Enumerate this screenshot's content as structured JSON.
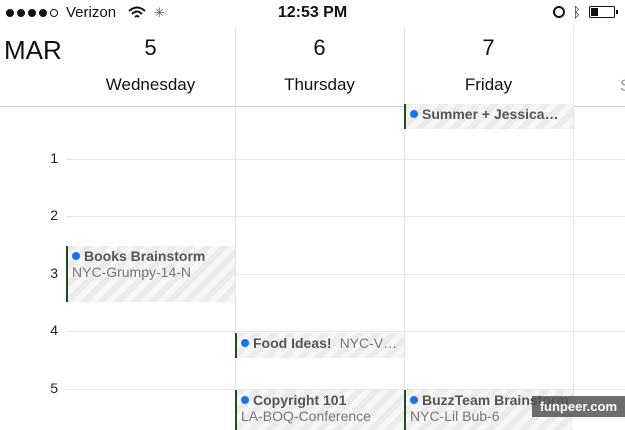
{
  "status_bar": {
    "carrier": "Verizon",
    "signal_bars_filled": 4,
    "signal_bars_total": 5,
    "time": "12:53 PM",
    "battery_level": 0.3
  },
  "header": {
    "month": "MAR",
    "days": [
      {
        "num": "5",
        "name": "Wednesday"
      },
      {
        "num": "6",
        "name": "Thursday"
      },
      {
        "num": "7",
        "name": "Friday"
      }
    ],
    "next_day_partial": "S"
  },
  "hours": [
    "1",
    "2",
    "3",
    "4",
    "5"
  ],
  "events": {
    "summer_jessica": {
      "title": "Summer + Jessica…"
    },
    "books_brainstorm": {
      "title": "Books Brainstorm",
      "location": "NYC-Grumpy-14-N"
    },
    "food_ideas": {
      "title": "Food Ideas!",
      "location": "NYC-V…"
    },
    "copyright_101": {
      "title": "Copyright 101",
      "location": "LA-BOQ-Conference"
    },
    "buzzteam_brainstorm": {
      "title": "BuzzTeam Brainstorm",
      "location": "NYC-Lil Bub-6"
    }
  },
  "watermark": "funpeer.com",
  "colors": {
    "event_dot": "#1a73e8",
    "event_border": "#1f4d1f"
  }
}
